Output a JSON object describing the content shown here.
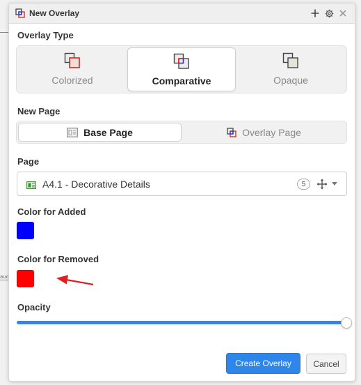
{
  "window": {
    "title": "New Overlay"
  },
  "overlay_type": {
    "label": "Overlay Type",
    "options": [
      {
        "label": "Colorized",
        "icon": "overlay-colorized-icon"
      },
      {
        "label": "Comparative",
        "icon": "overlay-comparative-icon"
      },
      {
        "label": "Opaque",
        "icon": "overlay-opaque-icon"
      }
    ],
    "selected": "Comparative"
  },
  "new_page": {
    "label": "New Page",
    "options": [
      {
        "label": "Base Page",
        "icon": "base-page-icon"
      },
      {
        "label": "Overlay Page",
        "icon": "overlay-page-icon"
      }
    ],
    "selected": "Base Page"
  },
  "page": {
    "label": "Page",
    "value": "A4.1 - Decorative Details",
    "count": "5"
  },
  "color_added": {
    "label": "Color for Added",
    "color": "#0000ff"
  },
  "color_removed": {
    "label": "Color for Removed",
    "color": "#ff0000"
  },
  "opacity": {
    "label": "Opacity",
    "value": 1.0
  },
  "buttons": {
    "create": "Create Overlay",
    "cancel": "Cancel"
  },
  "colors": {
    "accent": "#2f86ea",
    "slider": "#3f7fe6",
    "annotation_arrow": "#e02020"
  }
}
